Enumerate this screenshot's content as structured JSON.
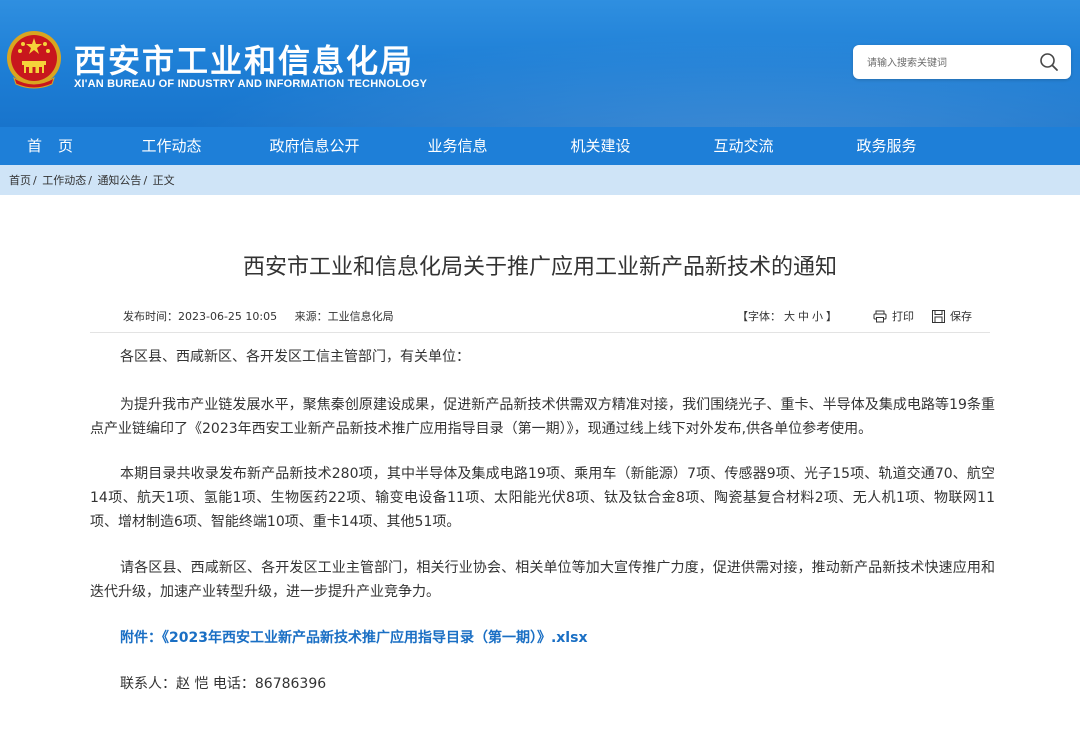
{
  "header": {
    "title": "西安市工业和信息化局",
    "subtitle": "XI'AN BUREAU OF INDUSTRY AND INFORMATION TECHNOLOGY",
    "search_placeholder": "请输入搜索关键词",
    "search_icon": "search-icon",
    "emblem_icon": "national-emblem-icon",
    "colors": {
      "header_bg": "#1e7fd6",
      "nav_bg": "#1e7fd8",
      "breadcrumb_bg": "#cfe4f7",
      "link": "#1a6fc4"
    }
  },
  "nav": {
    "items": [
      "首页",
      "工作动态",
      "政府信息公开",
      "业务信息",
      "机关建设",
      "互动交流",
      "政务服务"
    ]
  },
  "breadcrumb": {
    "items": [
      "首页",
      "工作动态",
      "通知公告",
      "正文"
    ],
    "separator": "/"
  },
  "article": {
    "title": "西安市工业和信息化局关于推广应用工业新产品新技术的通知",
    "publish_time": "发布时间：2023-06-25 10:05",
    "source": "来源：工业信息化局",
    "font_label": "【字体：",
    "font_large": "大",
    "font_medium": "中",
    "font_small": "小",
    "font_close": "】",
    "print_label": "打印",
    "save_label": "保存",
    "paragraphs": [
      "各区县、西咸新区、各开发区工信主管部门，有关单位：",
      "为提升我市产业链发展水平，聚焦秦创原建设成果，促进新产品新技术供需双方精准对接，我们围绕光子、重卡、半导体及集成电路等19条重点产业链编印了《2023年西安工业新产品新技术推广应用指导目录（第一期）》，现通过线上线下对外发布,供各单位参考使用。",
      "本期目录共收录发布新产品新技术280项，其中半导体及集成电路19项、乘用车（新能源）7项、传感器9项、光子15项、轨道交通70、航空14项、航天1项、氢能1项、生物医药22项、输变电设备11项、太阳能光伏8项、钛及钛合金8项、陶瓷基复合材料2项、无人机1项、物联网11项、增材制造6项、智能终端10项、重卡14项、其他51项。",
      "请各区县、西咸新区、各开发区工业主管部门，相关行业协会、相关单位等加大宣传推广力度，促进供需对接，推动新产品新技术快速应用和迭代升级，加速产业转型升级，进一步提升产业竞争力。"
    ],
    "attachment": "附件：《2023年西安工业新产品新技术推广应用指导目录（第一期）》.xlsx",
    "contact": "联系人：赵 恺 电话：86786396"
  }
}
